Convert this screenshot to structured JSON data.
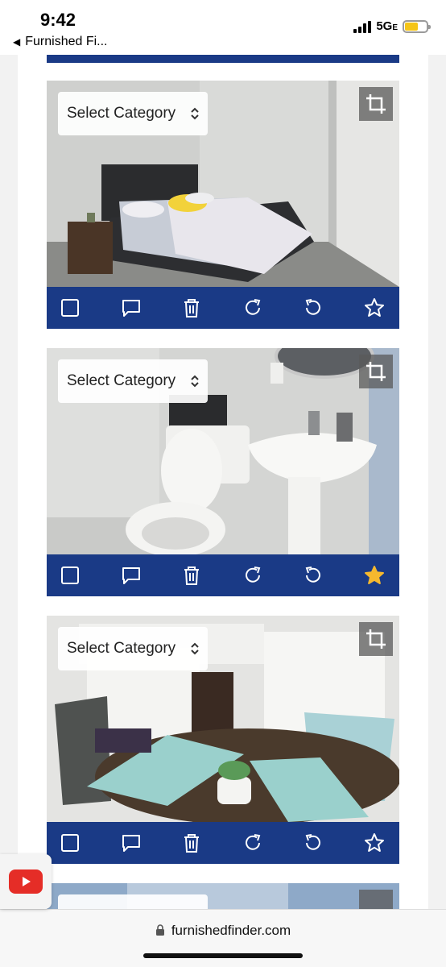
{
  "status_bar": {
    "time": "9:42",
    "back_label": "Furnished Fi...",
    "network": "5G",
    "network_suffix": "E",
    "battery_color": "#f5c518"
  },
  "accent_color": "#1a3a86",
  "photos": [
    {
      "category_label": "Select Category",
      "favorite": false,
      "scene": "bedroom"
    },
    {
      "category_label": "Select Category",
      "favorite": true,
      "scene": "bathroom"
    },
    {
      "category_label": "Select Category",
      "favorite": false,
      "scene": "kitchen"
    }
  ],
  "toolbar_icons": [
    "checkbox-icon",
    "comment-icon",
    "trash-icon",
    "rotate-right-icon",
    "rotate-left-icon",
    "star-icon"
  ],
  "browser": {
    "url": "furnishedfinder.com"
  }
}
